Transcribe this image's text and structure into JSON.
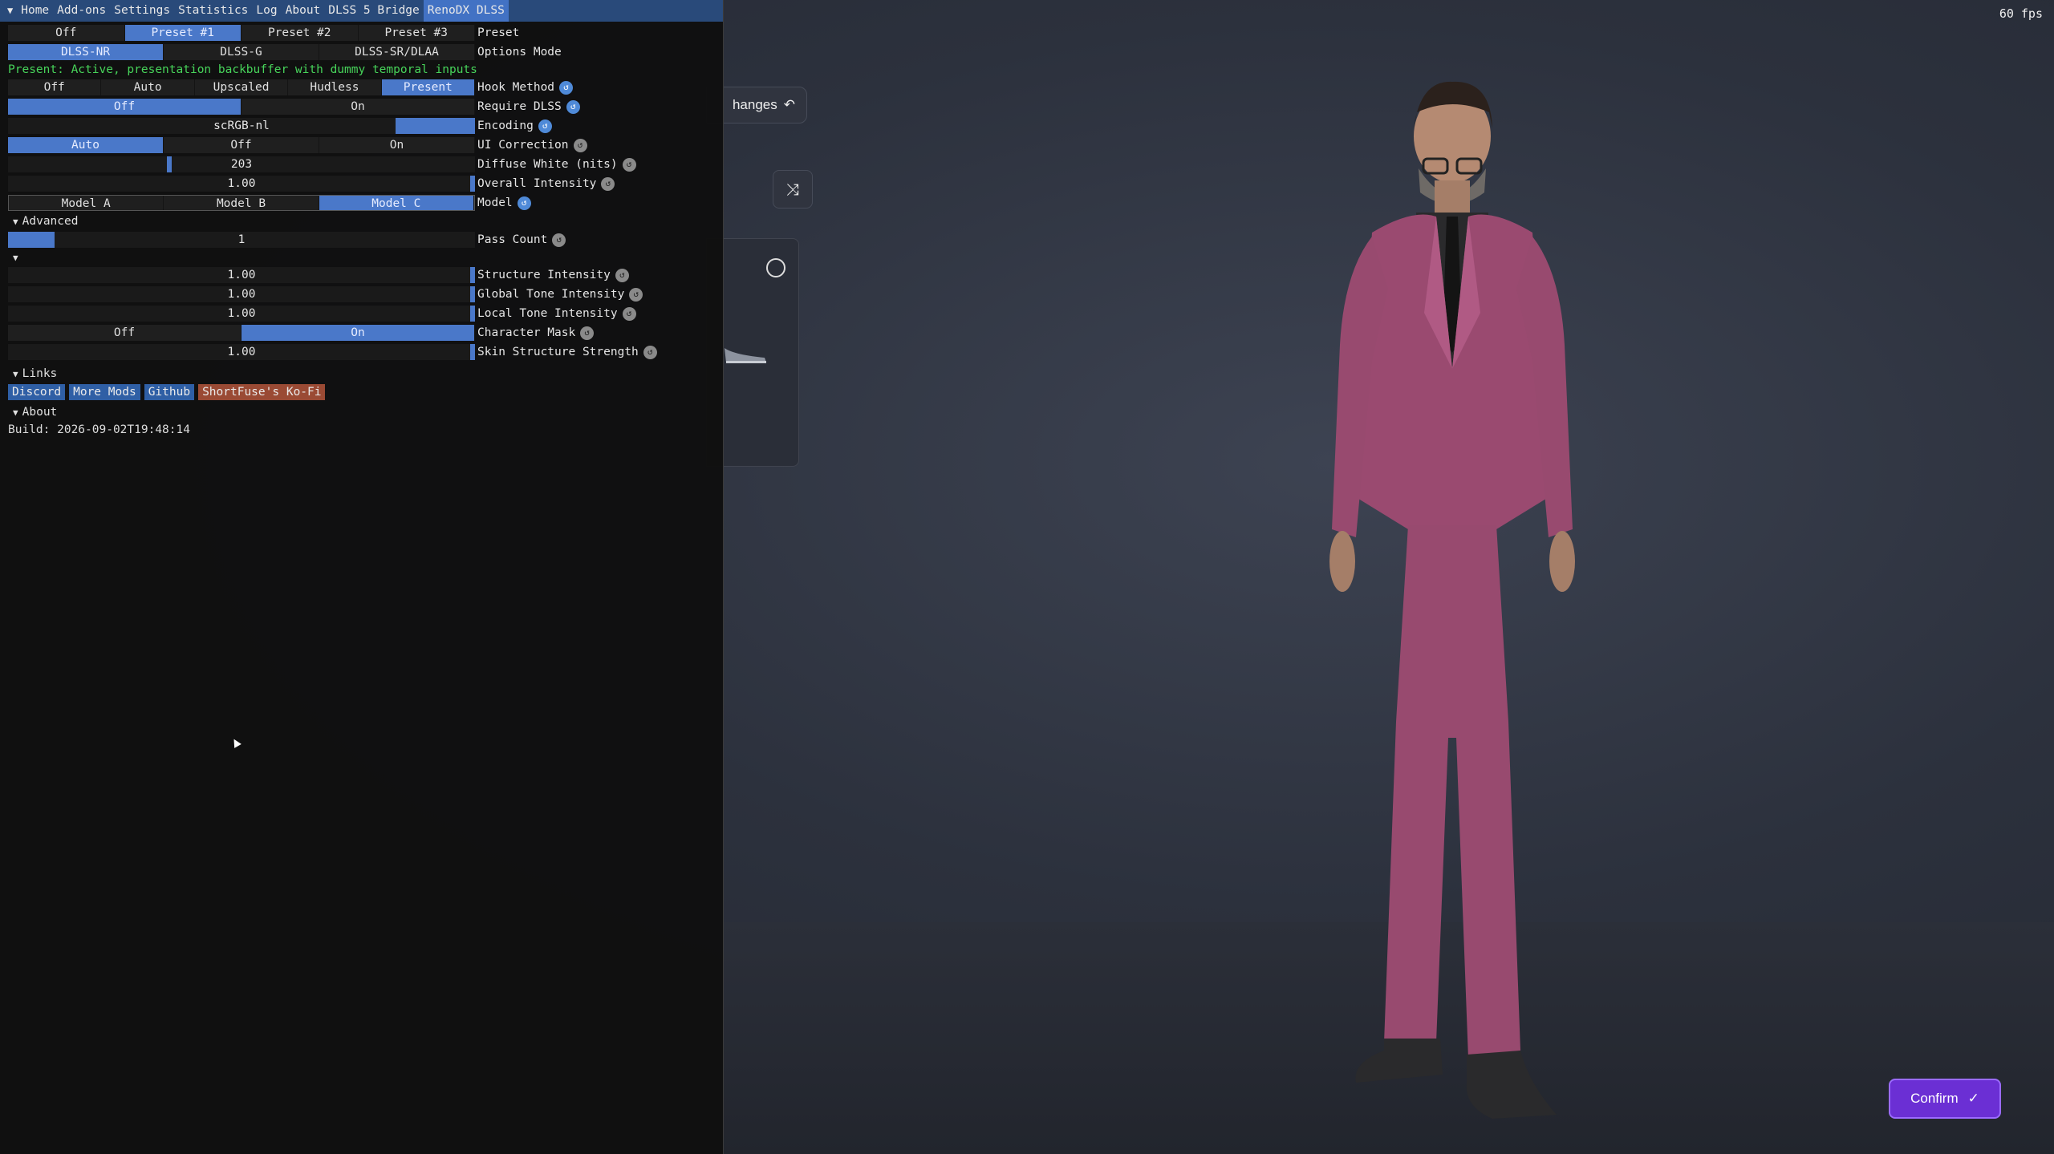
{
  "menubar": {
    "items": [
      "Home",
      "Add-ons",
      "Settings",
      "Statistics",
      "Log",
      "About",
      "DLSS 5 Bridge",
      "RenoDX DLSS"
    ],
    "active_index": 7
  },
  "preset": {
    "options": [
      "Off",
      "Preset #1",
      "Preset #2",
      "Preset #3"
    ],
    "selected": 1,
    "label": "Preset"
  },
  "options_mode": {
    "options": [
      "DLSS-NR",
      "DLSS-G",
      "DLSS-SR/DLAA"
    ],
    "selected": 0,
    "label": "Options Mode"
  },
  "status_text": "Present: Active, presentation backbuffer with dummy temporal inputs",
  "hook_method": {
    "options": [
      "Off",
      "Auto",
      "Upscaled",
      "Hudless",
      "Present"
    ],
    "selected": 4,
    "label": "Hook Method"
  },
  "require_dlss": {
    "options": [
      "Off",
      "On"
    ],
    "selected": 0,
    "label": "Require DLSS"
  },
  "encoding": {
    "value": "scRGB-nl",
    "label": "Encoding"
  },
  "ui_correction": {
    "options": [
      "Auto",
      "Off",
      "On"
    ],
    "selected": 0,
    "label": "UI Correction"
  },
  "diffuse_white": {
    "value": "203",
    "label": "Diffuse White (nits)"
  },
  "overall_intensity": {
    "value": "1.00",
    "label": "Overall Intensity"
  },
  "model": {
    "options": [
      "Model A",
      "Model B",
      "Model C"
    ],
    "selected": 2,
    "label": "Model"
  },
  "advanced": {
    "header": "Advanced"
  },
  "pass_count": {
    "value": "1",
    "label": "Pass Count"
  },
  "structure_intensity": {
    "value": "1.00",
    "label": "Structure Intensity"
  },
  "global_tone_intensity": {
    "value": "1.00",
    "label": "Global Tone Intensity"
  },
  "local_tone_intensity": {
    "value": "1.00",
    "label": "Local Tone Intensity"
  },
  "character_mask": {
    "options": [
      "Off",
      "On"
    ],
    "selected": 1,
    "label": "Character Mask"
  },
  "skin_structure_strength": {
    "value": "1.00",
    "label": "Skin Structure Strength"
  },
  "links": {
    "header": "Links",
    "items": [
      "Discord",
      "More Mods",
      "Github",
      "ShortFuse's Ko-Fi"
    ]
  },
  "about": {
    "header": "About",
    "build": "Build: 2026-09-02T19:48:14"
  },
  "game": {
    "fps": "60 fps",
    "changes_label": "hanges",
    "confirm_label": "Confirm"
  },
  "colors": {
    "accent": "#4a78c9",
    "menubar": "#294a7a",
    "status_green": "#47d45a",
    "confirm": "#6b2fd4"
  }
}
